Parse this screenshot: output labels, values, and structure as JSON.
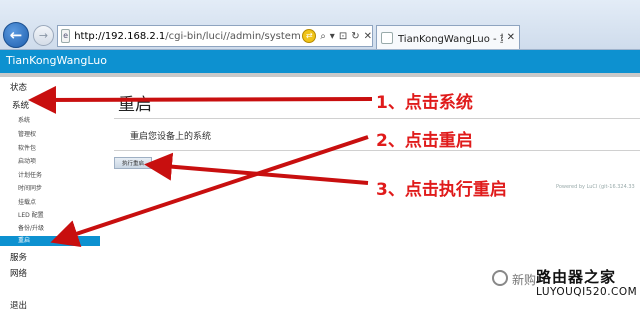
{
  "browser": {
    "url_host": "http://192.168.2.1",
    "url_path": "/cgi-bin/luci//admin/system/rebo",
    "url_tools": [
      "⌕",
      "▾",
      "⊡",
      "↻",
      "✕"
    ],
    "tab_title": "TianKongWangLuo - 重...",
    "tab_close": "✕"
  },
  "header": {
    "brand": "TianKongWangLuo"
  },
  "sidebar": {
    "items": [
      {
        "label": "状态",
        "level": "top"
      },
      {
        "label": "系统",
        "level": "top",
        "highlight": true
      },
      {
        "label": "系统",
        "level": "sub"
      },
      {
        "label": "管理权",
        "level": "sub"
      },
      {
        "label": "软件包",
        "level": "sub"
      },
      {
        "label": "启动项",
        "level": "sub"
      },
      {
        "label": "计划任务",
        "level": "sub"
      },
      {
        "label": "时间同步",
        "level": "sub"
      },
      {
        "label": "挂载点",
        "level": "sub"
      },
      {
        "label": "LED 配置",
        "level": "sub"
      },
      {
        "label": "备份/升级",
        "level": "sub"
      },
      {
        "label": "重启",
        "level": "sub",
        "active": true
      },
      {
        "label": "服务",
        "level": "top"
      },
      {
        "label": "网络",
        "level": "top"
      },
      {
        "label": "退出",
        "level": "top"
      }
    ]
  },
  "main": {
    "title": "重启",
    "description": "重启您设备上的系统",
    "button_label": "执行重启",
    "footer": "Powered by LuCI (git-16.324.33"
  },
  "annotations": {
    "steps": [
      "1、点击系统",
      "2、点击重启",
      "3、点击执行重启"
    ],
    "arrow_color": "#c80f0f",
    "text_color": "#e01b1b"
  },
  "watermark": {
    "left": "新购",
    "brand": "路由器之家",
    "domain": "LUYOUQI520.COM"
  },
  "colors": {
    "header_blue": "#0d91d0",
    "active_menu": "#0d91d0"
  }
}
